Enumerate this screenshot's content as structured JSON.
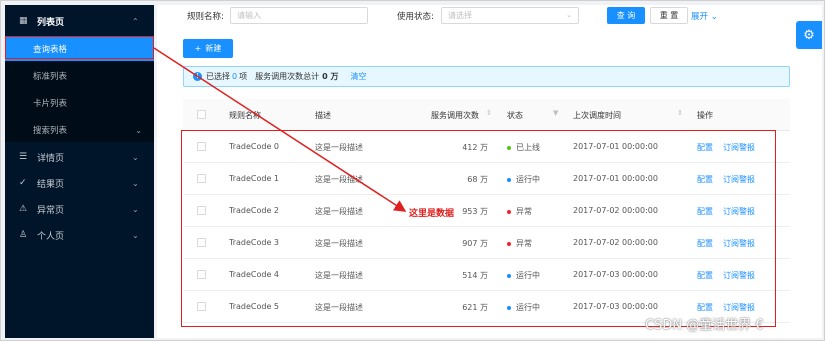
{
  "sidebar": {
    "list_menu": {
      "label": "列表页",
      "icon": "table-icon"
    },
    "sub_items": [
      {
        "label": "查询表格",
        "active": true
      },
      {
        "label": "标准列表",
        "active": false
      },
      {
        "label": "卡片列表",
        "active": false
      },
      {
        "label": "搜索列表",
        "active": false
      }
    ],
    "groups": [
      {
        "label": "详情页",
        "icon": "profile-icon"
      },
      {
        "label": "结果页",
        "icon": "check-circle-icon"
      },
      {
        "label": "异常页",
        "icon": "warning-icon"
      },
      {
        "label": "个人页",
        "icon": "user-icon"
      }
    ]
  },
  "filters": {
    "rule_name_label": "规则名称:",
    "rule_name_placeholder": "请输入",
    "status_label": "使用状态:",
    "status_placeholder": "请选择",
    "query_button": "查 询",
    "reset_button": "重 置",
    "expand_link": "展开"
  },
  "toolbar": {
    "new_button": "新建"
  },
  "alert": {
    "selected_prefix": "已选择",
    "selected_count": "0",
    "selected_suffix": "项",
    "total_text": "服务调用次数总计",
    "total_value": "0 万",
    "clear_link": "清空"
  },
  "table": {
    "columns": [
      "规则名称",
      "描述",
      "服务调用次数",
      "状态",
      "上次调度时间",
      "操作"
    ],
    "rows": [
      {
        "name": "TradeCode 0",
        "desc": "这是一段描述",
        "calls": "412 万",
        "status": "已上线",
        "status_color": "#52c41a",
        "time": "2017-07-01 00:00:00",
        "action1": "配置",
        "action2": "订阅警报"
      },
      {
        "name": "TradeCode 1",
        "desc": "这是一段描述",
        "calls": "68 万",
        "status": "运行中",
        "status_color": "#1890ff",
        "time": "2017-07-01 00:00:00",
        "action1": "配置",
        "action2": "订阅警报"
      },
      {
        "name": "TradeCode 2",
        "desc": "这是一段描述",
        "calls": "953 万",
        "status": "异常",
        "status_color": "#f5222d",
        "time": "2017-07-02 00:00:00",
        "action1": "配置",
        "action2": "订阅警报"
      },
      {
        "name": "TradeCode 3",
        "desc": "这是一段描述",
        "calls": "907 万",
        "status": "异常",
        "status_color": "#f5222d",
        "time": "2017-07-02 00:00:00",
        "action1": "配置",
        "action2": "订阅警报"
      },
      {
        "name": "TradeCode 4",
        "desc": "这是一段描述",
        "calls": "514 万",
        "status": "运行中",
        "status_color": "#1890ff",
        "time": "2017-07-03 00:00:00",
        "action1": "配置",
        "action2": "订阅警报"
      },
      {
        "name": "TradeCode 5",
        "desc": "这是一段描述",
        "calls": "621 万",
        "status": "运行中",
        "status_color": "#1890ff",
        "time": "2017-07-03 00:00:00",
        "action1": "配置",
        "action2": "订阅警报"
      }
    ]
  },
  "annotation": {
    "text": "这里是数据"
  },
  "watermark": {
    "text": "CSDN @童话世界 €"
  }
}
